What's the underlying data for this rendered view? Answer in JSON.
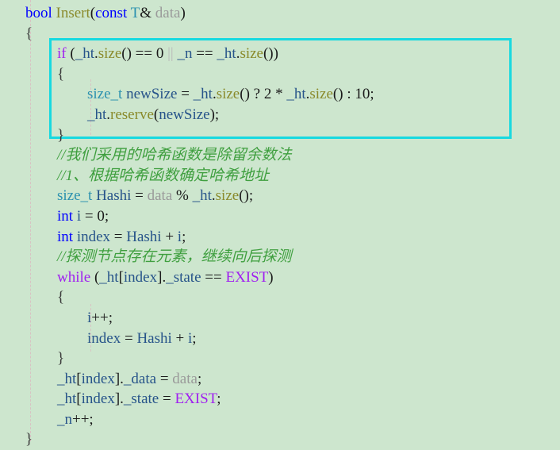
{
  "editor": {
    "background_color": "#cde6ce",
    "language": "C++",
    "highlight_box": {
      "color": "#17d9e0",
      "label": "resize-block-highlight"
    },
    "colors": {
      "keyword": "#0000ff",
      "control_keyword": "#a020f0",
      "type": "#2b91af",
      "function": "#8a8a2b",
      "identifier": "#27548a",
      "parameter": "#9a9a9a",
      "comment": "#3f9f3f",
      "punctuation": "#1a1a1a",
      "indent_guide": "#d8c3c3"
    },
    "lines": [
      {
        "n": 1,
        "text": "    bool Insert(const T& data)"
      },
      {
        "n": 2,
        "text": "    {"
      },
      {
        "n": 3,
        "text": "        if (_ht.size() == 0 || _n == _ht.size())"
      },
      {
        "n": 4,
        "text": "        {"
      },
      {
        "n": 5,
        "text": "            size_t newSize = _ht.size() ? 2 * _ht.size() : 10;"
      },
      {
        "n": 6,
        "text": "            _ht.reserve(newSize);"
      },
      {
        "n": 7,
        "text": "        }"
      },
      {
        "n": 8,
        "text": "        //我们采用的哈希函数是除留余数法"
      },
      {
        "n": 9,
        "text": "        //1、根据哈希函数确定哈希地址"
      },
      {
        "n": 10,
        "text": "        size_t Hashi = data % _ht.size();"
      },
      {
        "n": 11,
        "text": "        int i = 0;"
      },
      {
        "n": 12,
        "text": "        int index = Hashi + i;"
      },
      {
        "n": 13,
        "text": "        //探测节点存在元素，继续向后探测"
      },
      {
        "n": 14,
        "text": "        while (_ht[index]._state == EXIST)"
      },
      {
        "n": 15,
        "text": "        {"
      },
      {
        "n": 16,
        "text": "            i++;"
      },
      {
        "n": 17,
        "text": "            index = Hashi + i;"
      },
      {
        "n": 18,
        "text": "        }"
      },
      {
        "n": 19,
        "text": "        _ht[index]._data = data;"
      },
      {
        "n": 20,
        "text": "        _ht[index]._state = EXIST;"
      },
      {
        "n": 21,
        "text": "        _n++;"
      },
      {
        "n": 22,
        "text": "    }"
      }
    ],
    "tokens": {
      "l1": {
        "kw": "bool",
        "fn": "Insert",
        "p_open": "(",
        "kw2": "const",
        "type": "T",
        "amp": "&",
        "param": "data",
        "p_close": ")"
      },
      "l2": {
        "brace": "{"
      },
      "l3": {
        "kw": "if",
        "open": " (",
        "obj": "_ht",
        "dot": ".",
        "fn": "size",
        "call": "() == ",
        "num": "0",
        "or": " || ",
        "n": "_n",
        "eq": " == ",
        "obj2": "_ht",
        "dot2": ".",
        "fn2": "size",
        "end": "())"
      },
      "l4": {
        "brace": "{"
      },
      "l5": {
        "type": "size_t",
        "var": "newSize",
        "assign": " = ",
        "obj": "_ht",
        "dot": ".",
        "fn": "size",
        "q": "() ? ",
        "two": "2",
        "star": " * ",
        "obj2": "_ht",
        "dot2": ".",
        "fn2": "size",
        "colon": "() : ",
        "ten": "10",
        "semi": ";"
      },
      "l6": {
        "obj": "_ht",
        "dot": ".",
        "fn": "reserve",
        "open": "(",
        "var": "newSize",
        "end": ");"
      },
      "l7": {
        "brace": "}"
      },
      "l8": {
        "comment": "//我们采用的哈希函数是除留余数法"
      },
      "l9": {
        "comment": "//1、根据哈希函数确定哈希地址"
      },
      "l10": {
        "type": "size_t",
        "var": "Hashi",
        "assign": " = ",
        "param": "data",
        "mod": " % ",
        "obj": "_ht",
        "dot": ".",
        "fn": "size",
        "end": "();"
      },
      "l11": {
        "kw": "int",
        "var": " i",
        "assign": " = ",
        "num": "0",
        "semi": ";"
      },
      "l12": {
        "kw": "int",
        "var": " index",
        "assign": " = ",
        "var2": "Hashi",
        "plus": " + ",
        "var3": "i",
        "semi": ";"
      },
      "l13": {
        "comment": "//探测节点存在元素，继续向后探测"
      },
      "l14": {
        "kw2": "while",
        "open": " (",
        "obj": "_ht",
        "br": "[",
        "idx": "index",
        "br2": "]",
        "dot": ".",
        "state": "_state",
        "eq": " == ",
        "exist": "EXIST",
        "close": ")"
      },
      "l15": {
        "brace": "{"
      },
      "l16": {
        "var": "i",
        "inc": "++;"
      },
      "l17": {
        "var": "index",
        "assign": " = ",
        "var2": "Hashi",
        "plus": " + ",
        "var3": "i",
        "semi": ";"
      },
      "l18": {
        "brace": "}"
      },
      "l19": {
        "obj": "_ht",
        "br": "[",
        "idx": "index",
        "br2": "]",
        "dot": ".",
        "field": "_data",
        "assign": " = ",
        "param": "data",
        "semi": ";"
      },
      "l20": {
        "obj": "_ht",
        "br": "[",
        "idx": "index",
        "br2": "]",
        "dot": ".",
        "field": "_state",
        "assign": " = ",
        "exist": "EXIST",
        "semi": ";"
      },
      "l21": {
        "var": "_n",
        "inc": "++;"
      },
      "l22": {
        "brace": "}"
      }
    }
  }
}
